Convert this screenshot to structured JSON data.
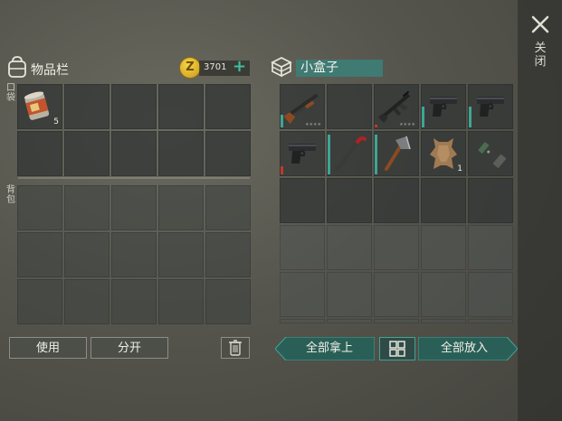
{
  "inventory": {
    "title": "物品栏",
    "coins": "3701",
    "pocket_label": "口袋",
    "backpack_label": "背包",
    "pocket_slots": [
      {
        "item": "canned-food",
        "count": "5"
      },
      {},
      {},
      {},
      {},
      {},
      {},
      {},
      {},
      {}
    ],
    "backpack_slots_count": 15
  },
  "actions": {
    "use_label": "使用",
    "split_label": "分开"
  },
  "container": {
    "name": "小盒子",
    "slots": [
      {
        "item": "shotgun",
        "durability": 0.3,
        "stars": "★★★★"
      },
      {},
      {
        "item": "assault-rifle",
        "durability": 0.05,
        "stars": "★★★★"
      },
      {
        "item": "pistol",
        "durability": 0.5,
        "stars": ""
      },
      {
        "item": "pistol",
        "durability": 0.5,
        "stars": ""
      },
      {
        "item": "pistol",
        "durability": 0.2,
        "stars": ""
      },
      {
        "item": "crowbar",
        "durability": 0.95,
        "stars": ""
      },
      {
        "item": "hatchet",
        "durability": 0.95,
        "stars": ""
      },
      {
        "item": "leather",
        "count": "1"
      },
      {
        "item": "flashlight"
      }
    ],
    "dim_rows": 3
  },
  "transfer": {
    "take_all_label": "全部拿上",
    "put_all_label": "全部放入"
  },
  "close_label": "关闭",
  "colors": {
    "accent": "#3fa594",
    "durability_high": "#3fa594",
    "durability_low": "#c0392b",
    "coin": "#e0b32a"
  }
}
